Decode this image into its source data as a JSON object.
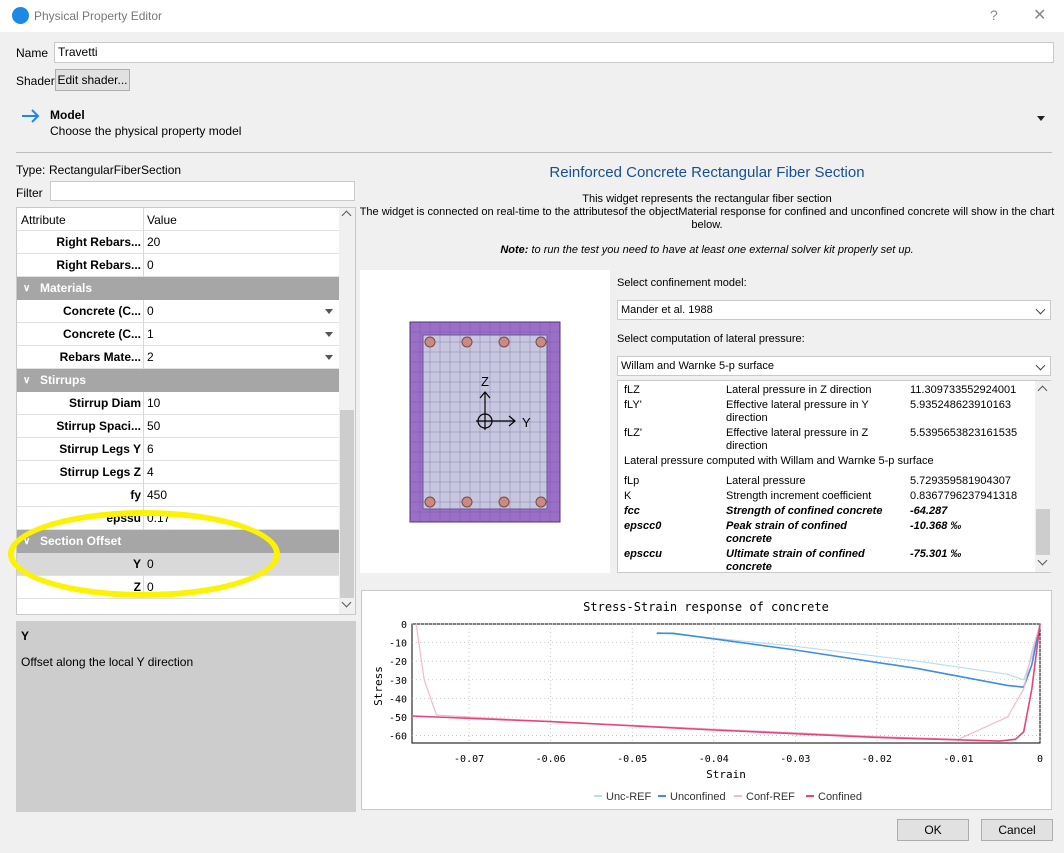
{
  "window": {
    "title": "Physical Property Editor",
    "help": "?",
    "close": "✕"
  },
  "name": {
    "label": "Name",
    "value": "Travetti"
  },
  "shader": {
    "label": "Shader",
    "button": "Edit shader..."
  },
  "model": {
    "title": "Model",
    "subtitle": "Choose the physical property model"
  },
  "type": {
    "label": "Type:",
    "value": "RectangularFiberSection"
  },
  "filter": {
    "label": "Filter",
    "value": ""
  },
  "table": {
    "col_attr": "Attribute",
    "col_value": "Value",
    "rows": [
      {
        "kind": "row",
        "k": "Right Rebars...",
        "v": "20"
      },
      {
        "kind": "row",
        "k": "Right Rebars...",
        "v": "0"
      },
      {
        "kind": "group",
        "k": "Materials"
      },
      {
        "kind": "row",
        "k": "Concrete (C...",
        "v": "0",
        "dd": true
      },
      {
        "kind": "row",
        "k": "Concrete (C...",
        "v": "1",
        "dd": true
      },
      {
        "kind": "row",
        "k": "Rebars Mate...",
        "v": "2",
        "dd": true
      },
      {
        "kind": "group",
        "k": "Stirrups"
      },
      {
        "kind": "row",
        "k": "Stirrup Diam",
        "v": "10"
      },
      {
        "kind": "row",
        "k": "Stirrup Spaci...",
        "v": "50"
      },
      {
        "kind": "row",
        "k": "Stirrup Legs Y",
        "v": "6"
      },
      {
        "kind": "row",
        "k": "Stirrup Legs Z",
        "v": "4"
      },
      {
        "kind": "row",
        "k": "fy",
        "v": "450"
      },
      {
        "kind": "row",
        "k": "epssu",
        "v": "0.17"
      },
      {
        "kind": "group",
        "k": "Section Offset"
      },
      {
        "kind": "row",
        "k": "Y",
        "v": "0",
        "sel": true
      },
      {
        "kind": "row",
        "k": "Z",
        "v": "0"
      }
    ]
  },
  "description": {
    "title": "Y",
    "text": "Offset along the local Y direction"
  },
  "widget": {
    "title": "Reinforced Concrete Rectangular Fiber Section",
    "line1": "This widget represents the rectangular fiber section",
    "line2": "The widget is connected on real-time to the attributesof the objectMaterial response for confined and unconfined concrete will show in the chart",
    "line3": "below.",
    "note_bold": "Note:",
    "note_text": " to run the test you need to have at least one external solver kit properly set up."
  },
  "section_axes": {
    "z": "Z",
    "y": "Y"
  },
  "confinement": {
    "label": "Select confinement model:",
    "value": "Mander et al. 1988"
  },
  "lateral": {
    "label": "Select computation of lateral pressure:",
    "value": "Willam and Warnke 5-p surface"
  },
  "results": [
    {
      "name": "fLZ",
      "desc": "Lateral pressure in Z direction",
      "value": "11.309733552924001"
    },
    {
      "name": "fLY'",
      "desc": "Effective lateral pressure in Y",
      "desc2": "direction",
      "value": "5.935248623910163"
    },
    {
      "name": "fLZ'",
      "desc": "Effective lateral pressure in Z",
      "desc2": "direction",
      "value": "5.5395653823161535"
    },
    {
      "name": "fLp",
      "desc": "Lateral pressure",
      "value": "5.729359581904307"
    },
    {
      "name": "K",
      "desc": "Strength increment coefficient",
      "value": "0.8367796237941318"
    },
    {
      "name": "fcc",
      "desc": "Strength of confined concrete",
      "value": "-64.287"
    },
    {
      "name": "epscc0",
      "desc": "Peak strain of confined",
      "desc2": "concrete",
      "value": "-10.368 ‰"
    },
    {
      "name": "epsccu",
      "desc": "Ultimate strain of confined",
      "desc2": "concrete",
      "value": "-75.301 ‰"
    }
  ],
  "results_heading": "Lateral pressure computed with Willam and Warnke 5-p surface",
  "chart_data": {
    "type": "line",
    "title": "Stress-Strain response of concrete",
    "xlabel": "Strain",
    "ylabel": "Stress",
    "xlim": [
      -0.077,
      0.0
    ],
    "ylim": [
      -64,
      0
    ],
    "xticks": [
      "-0.07",
      "-0.06",
      "-0.05",
      "-0.04",
      "-0.03",
      "-0.02",
      "-0.01",
      "0"
    ],
    "yticks": [
      "0",
      "-10",
      "-20",
      "-30",
      "-40",
      "-50",
      "-60"
    ],
    "grid": true,
    "legend": "bottom",
    "series": [
      {
        "name": "Unc-REF",
        "color": "#b9dcf3",
        "x": [
          -0.047,
          -0.03,
          -0.015,
          -0.004,
          -0.002,
          -0.001,
          0.0
        ],
        "y": [
          -4.5,
          -12,
          -20,
          -27,
          -30,
          -18,
          0
        ]
      },
      {
        "name": "Unconfined",
        "color": "#3d8fdb",
        "x": [
          -0.047,
          -0.045,
          -0.03,
          -0.015,
          -0.004,
          -0.002,
          -0.001,
          0.0
        ],
        "y": [
          -5,
          -5,
          -14,
          -24,
          -33,
          -34,
          -22,
          0
        ]
      },
      {
        "name": "Conf-REF",
        "color": "#f6b8cd",
        "x": [
          -0.0765,
          -0.0755,
          -0.074,
          -0.06,
          -0.04,
          -0.02,
          -0.01,
          -0.004,
          -0.002,
          -0.001,
          0.0
        ],
        "y": [
          0,
          -30,
          -49,
          -52.5,
          -56.5,
          -60.5,
          -62,
          -50,
          -35,
          -15,
          0
        ]
      },
      {
        "name": "Confined",
        "color": "#e8447a",
        "x": [
          -0.077,
          -0.06,
          -0.04,
          -0.02,
          -0.005,
          -0.003,
          -0.002,
          -0.001,
          0.0
        ],
        "y": [
          -49.5,
          -52.5,
          -57,
          -61,
          -63,
          -62,
          -58,
          -35,
          0
        ]
      }
    ]
  },
  "buttons": {
    "ok": "OK",
    "cancel": "Cancel"
  },
  "colors": {
    "accent": "#1e88e5",
    "group_header": "#a6a6a6",
    "section_fill": "#9b6fc7",
    "highlight": "#fbf205"
  }
}
